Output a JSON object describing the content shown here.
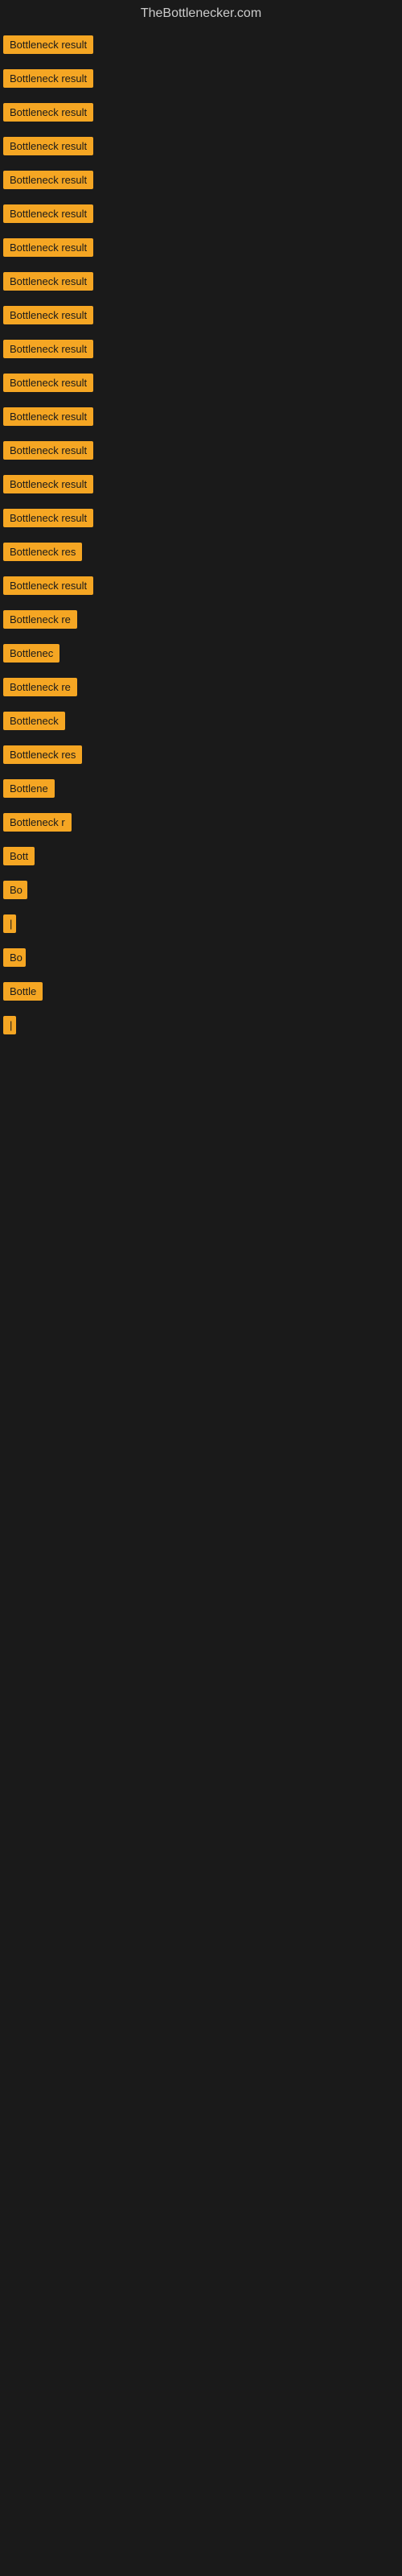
{
  "header": {
    "title": "TheBottlenecker.com"
  },
  "items": [
    {
      "label": "Bottleneck result",
      "width": 155
    },
    {
      "label": "Bottleneck result",
      "width": 155
    },
    {
      "label": "Bottleneck result",
      "width": 155
    },
    {
      "label": "Bottleneck result",
      "width": 155
    },
    {
      "label": "Bottleneck result",
      "width": 155
    },
    {
      "label": "Bottleneck result",
      "width": 155
    },
    {
      "label": "Bottleneck result",
      "width": 155
    },
    {
      "label": "Bottleneck result",
      "width": 155
    },
    {
      "label": "Bottleneck result",
      "width": 155
    },
    {
      "label": "Bottleneck result",
      "width": 155
    },
    {
      "label": "Bottleneck result",
      "width": 155
    },
    {
      "label": "Bottleneck result",
      "width": 155
    },
    {
      "label": "Bottleneck result",
      "width": 155
    },
    {
      "label": "Bottleneck result",
      "width": 155
    },
    {
      "label": "Bottleneck result",
      "width": 155
    },
    {
      "label": "Bottleneck res",
      "width": 120
    },
    {
      "label": "Bottleneck result",
      "width": 145
    },
    {
      "label": "Bottleneck re",
      "width": 110
    },
    {
      "label": "Bottlenec",
      "width": 90
    },
    {
      "label": "Bottleneck re",
      "width": 108
    },
    {
      "label": "Bottleneck",
      "width": 88
    },
    {
      "label": "Bottleneck res",
      "width": 118
    },
    {
      "label": "Bottlene",
      "width": 80
    },
    {
      "label": "Bottleneck r",
      "width": 100
    },
    {
      "label": "Bott",
      "width": 50
    },
    {
      "label": "Bo",
      "width": 30
    },
    {
      "label": "|",
      "width": 10
    },
    {
      "label": "Bo",
      "width": 28
    },
    {
      "label": "Bottle",
      "width": 55
    },
    {
      "label": "|",
      "width": 8
    }
  ]
}
